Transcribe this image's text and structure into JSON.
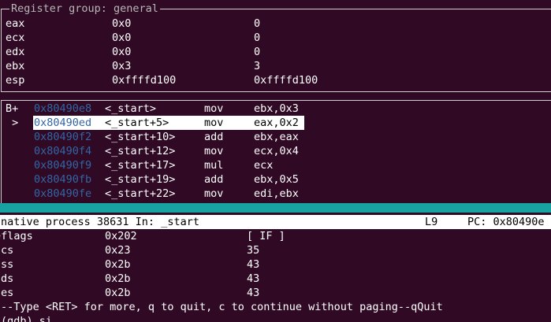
{
  "register_pane": {
    "title": "Register group: general",
    "rows": [
      {
        "name": "eax",
        "hex": "0x0",
        "natural": "0"
      },
      {
        "name": "ecx",
        "hex": "0x0",
        "natural": "0"
      },
      {
        "name": "edx",
        "hex": "0x0",
        "natural": "0"
      },
      {
        "name": "ebx",
        "hex": "0x3",
        "natural": "3"
      },
      {
        "name": "esp",
        "hex": "0xffffd100",
        "natural": "0xffffd100"
      }
    ]
  },
  "asm_pane": {
    "rows": [
      {
        "marker": "B+",
        "addr": "0x80490e8",
        "sym": "<_start>",
        "op": "mov",
        "args": "ebx,0x3"
      },
      {
        "marker": " >",
        "addr": "0x80490ed",
        "sym": "<_start+5>",
        "op": "mov",
        "args": "eax,0x2"
      },
      {
        "marker": "",
        "addr": "0x80490f2",
        "sym": "<_start+10>",
        "op": "add",
        "args": "ebx,eax"
      },
      {
        "marker": "",
        "addr": "0x80490f4",
        "sym": "<_start+12>",
        "op": "mov",
        "args": "ecx,0x4"
      },
      {
        "marker": "",
        "addr": "0x80490f9",
        "sym": "<_start+17>",
        "op": "mul",
        "args": "ecx"
      },
      {
        "marker": "",
        "addr": "0x80490fb",
        "sym": "<_start+19>",
        "op": "add",
        "args": "ebx,0x5"
      },
      {
        "marker": "",
        "addr": "0x80490fe",
        "sym": "<_start+22>",
        "op": "mov",
        "args": "edi,ebx"
      }
    ],
    "current_index": 1
  },
  "status_line": {
    "process": "native process 38631 In: _start",
    "line": "L9",
    "pc": "PC: 0x80490e"
  },
  "command_output": {
    "registers": [
      {
        "name": "eflags",
        "hex": "0x202",
        "natural": "[ IF ]"
      },
      {
        "name": "cs",
        "hex": "0x23",
        "natural": "35"
      },
      {
        "name": "ss",
        "hex": "0x2b",
        "natural": "43"
      },
      {
        "name": "ds",
        "hex": "0x2b",
        "natural": "43"
      },
      {
        "name": "es",
        "hex": "0x2b",
        "natural": "43"
      }
    ],
    "paging_prompt": "--Type <RET> for more, q to quit, c to continue without paging--qQuit",
    "prompt_line": "(gdb) si"
  },
  "colors": {
    "background": "#300a24",
    "address": "#3465a4",
    "border_bar": "#18a3a3"
  }
}
